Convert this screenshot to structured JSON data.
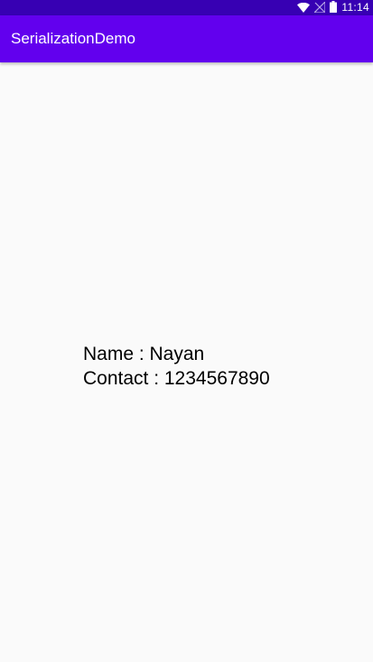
{
  "status_bar": {
    "time": "11:14",
    "icons": [
      "wifi-icon",
      "signal-off-icon",
      "battery-icon"
    ],
    "background": "#3700B3"
  },
  "app_bar": {
    "title": "SerializationDemo",
    "background": "#6200EE"
  },
  "content": {
    "lines": [
      {
        "label": "Name",
        "separator": " : ",
        "value": "Nayan",
        "text": "Name : Nayan"
      },
      {
        "label": "Contact",
        "separator": " : ",
        "value": "1234567890",
        "text": "Contact : 1234567890"
      }
    ]
  }
}
